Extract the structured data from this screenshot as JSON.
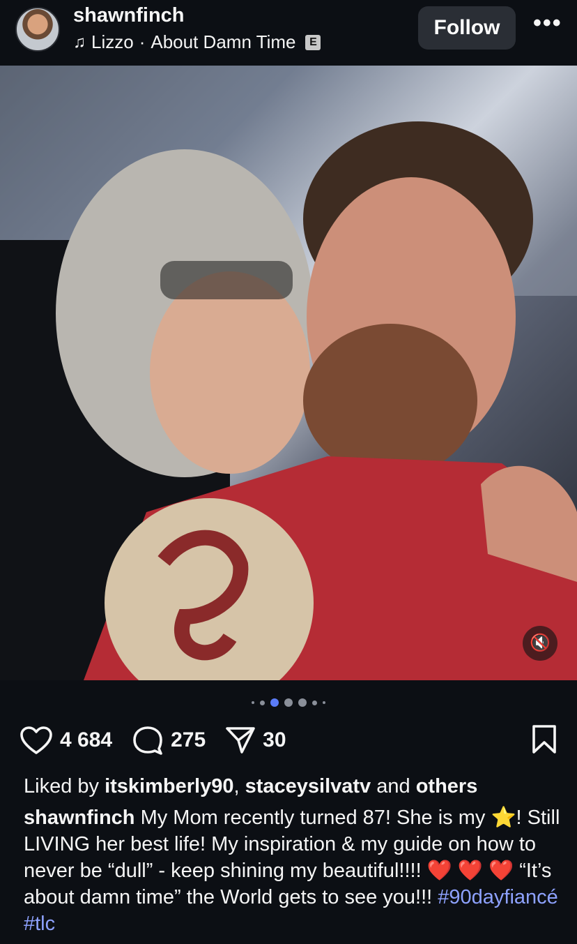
{
  "header": {
    "username": "shawnfinch",
    "music_artist": "Lizzo",
    "music_sep": "·",
    "music_title": "About Damn Time",
    "explicit": "E",
    "follow_label": "Follow",
    "more": "•••"
  },
  "carousel": {
    "count": 7,
    "active_index": 2
  },
  "icons": {
    "note": "♫",
    "mute": "🔇",
    "heart": "heart-icon",
    "comment": "comment-icon",
    "share": "share-icon",
    "bookmark": "bookmark-icon"
  },
  "counts": {
    "likes": "4 684",
    "comments": "275",
    "shares": "30"
  },
  "liked_by": {
    "prefix": "Liked by",
    "user1": "itskimberly90",
    "sep": ",",
    "user2": "staceysilvatv",
    "and": "and",
    "others": "others"
  },
  "caption": {
    "author": "shawnfinch",
    "text1": "My Mom recently turned 87! She is my",
    "star": "⭐",
    "text2": "! Still LIVING her best life! My inspiration & my guide on how to never be “dull” - keep shining my beautiful!!!!",
    "hearts": "❤️ ❤️ ❤️",
    "text3": "“It’s about damn time” the World gets to see you!!!",
    "hashtag1": "#90dayfiancé",
    "hashtag2": "#tlc"
  },
  "colors": {
    "background": "#0c0f14",
    "accent": "#5b7cf7",
    "hashtag": "#8ea2ff"
  }
}
